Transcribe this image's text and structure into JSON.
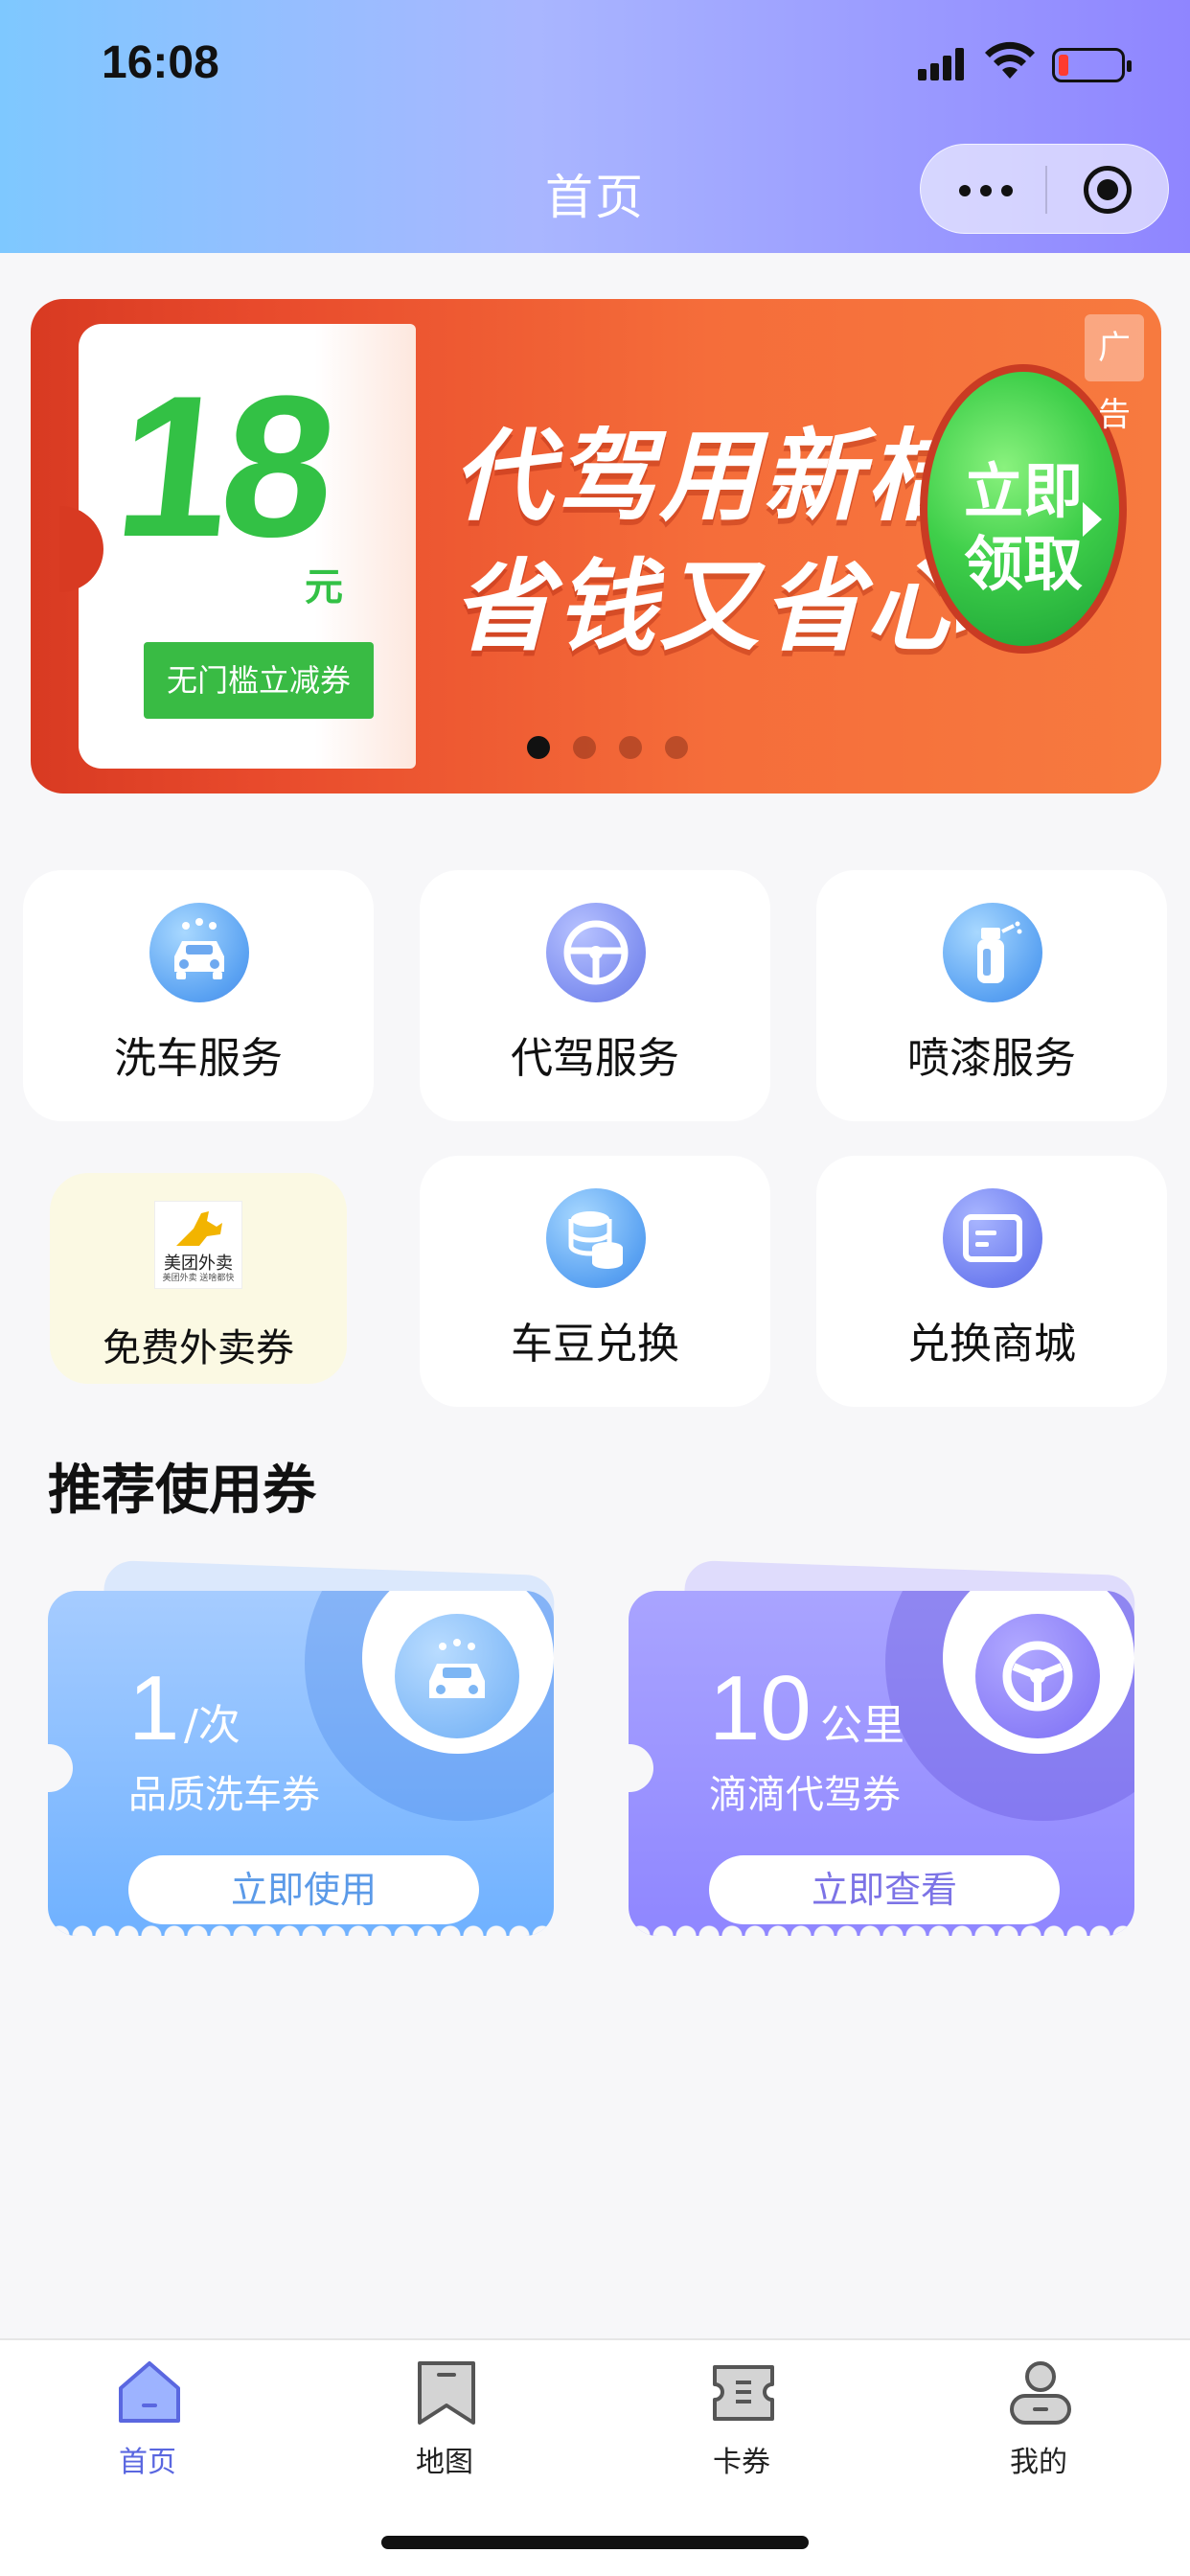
{
  "status_bar": {
    "time": "16:08"
  },
  "header": {
    "title": "首页"
  },
  "banner": {
    "coupon_amount": "18",
    "coupon_unit": "元",
    "coupon_tag": "无门槛立减券",
    "slogan_line1": "代驾用新桔",
    "slogan_line2": "省钱又省心",
    "claim_line1": "立即",
    "claim_line2": "领取",
    "ad_label": "广告",
    "page_count": 4,
    "active_page": 1
  },
  "services": [
    {
      "label": "洗车服务",
      "icon": "car-wash-icon"
    },
    {
      "label": "代驾服务",
      "icon": "steering-wheel-icon"
    },
    {
      "label": "喷漆服务",
      "icon": "spray-can-icon"
    },
    {
      "label": "免费外卖券",
      "icon": "meituan-logo",
      "logo_name": "美团外卖",
      "logo_sub": "美团外卖 送啥都快"
    },
    {
      "label": "车豆兑换",
      "icon": "coins-stack-icon"
    },
    {
      "label": "兑换商城",
      "icon": "card-icon"
    }
  ],
  "recommend": {
    "title": "推荐使用券",
    "coupons": [
      {
        "value": "1",
        "unit": "/次",
        "desc": "品质洗车券",
        "cta": "立即使用",
        "icon": "car-wash-icon"
      },
      {
        "value": "10",
        "unit": "公里",
        "desc": "滴滴代驾券",
        "cta": "立即查看",
        "icon": "steering-wheel-icon"
      }
    ]
  },
  "tabbar": [
    {
      "label": "首页",
      "icon": "home-icon",
      "active": true
    },
    {
      "label": "地图",
      "icon": "map-icon",
      "active": false
    },
    {
      "label": "卡券",
      "icon": "coupon-icon",
      "active": false
    },
    {
      "label": "我的",
      "icon": "profile-icon",
      "active": false
    }
  ],
  "colors": {
    "header_gradient": [
      "#7ec8ff",
      "#8f85ff"
    ],
    "banner_red": "#e84a2c",
    "coupon_green": "#33c145",
    "tab_active": "#5a67e0"
  }
}
